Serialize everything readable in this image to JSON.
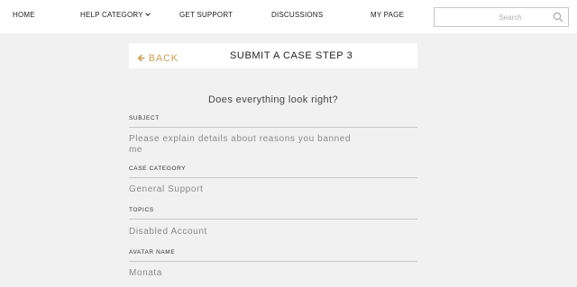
{
  "nav": {
    "items": [
      {
        "label": "HOME"
      },
      {
        "label": "HELP CATEGORY"
      },
      {
        "label": "GET SUPPORT"
      },
      {
        "label": "DISCUSSIONS"
      },
      {
        "label": "MY PAGE"
      }
    ],
    "search_placeholder": "Search"
  },
  "header": {
    "back_label": "BACK",
    "title": "SUBMIT A CASE STEP 3"
  },
  "form": {
    "question": "Does everything look right?",
    "fields": [
      {
        "label": "SUBJECT",
        "value_line1": "Please explain details about reasons you banned",
        "value_line2": "me"
      },
      {
        "label": "CASE CATEGORY",
        "value": "General Support"
      },
      {
        "label": "TOPICS",
        "value": "Disabled Account"
      },
      {
        "label": "AVATAR NAME",
        "value": "Monata"
      }
    ]
  },
  "colors": {
    "accent": "#c9a25d",
    "page_bg": "#f1f1f1"
  }
}
